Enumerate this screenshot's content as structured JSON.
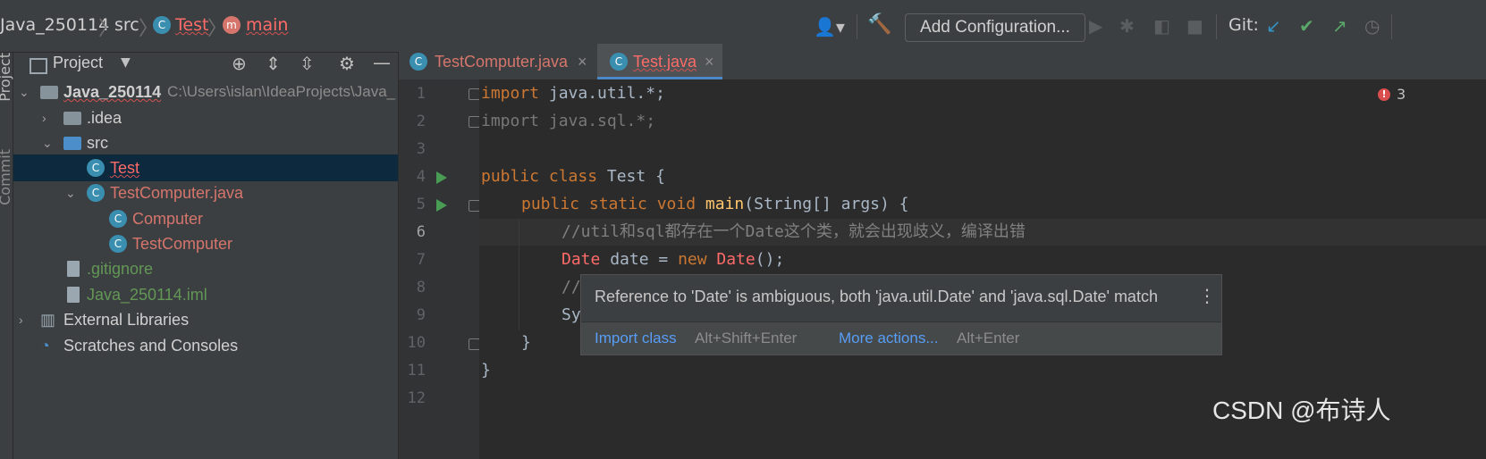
{
  "breadcrumb": {
    "project": "Java_250114",
    "src": "src",
    "class": "Test",
    "method": "main"
  },
  "toolbar": {
    "add_configuration": "Add Configuration...",
    "git_label": "Git:"
  },
  "side_tabs": {
    "project": "Project",
    "commit": "Commit"
  },
  "project_panel": {
    "title": "Project",
    "tree": [
      {
        "label": "Java_250114",
        "path": "C:\\Users\\islan\\IdeaProjects\\Java_"
      },
      {
        "label": ".idea"
      },
      {
        "label": "src"
      },
      {
        "label": "Test"
      },
      {
        "label": "TestComputer.java"
      },
      {
        "label": "Computer"
      },
      {
        "label": "TestComputer"
      },
      {
        "label": ".gitignore"
      },
      {
        "label": "Java_250114.iml"
      },
      {
        "label": "External Libraries"
      },
      {
        "label": "Scratches and Consoles"
      }
    ]
  },
  "editor_tabs": [
    {
      "label": "TestComputer.java"
    },
    {
      "label": "Test.java"
    }
  ],
  "line_numbers": [
    "1",
    "2",
    "3",
    "4",
    "5",
    "6",
    "7",
    "8",
    "9",
    "10",
    "11",
    "12"
  ],
  "code": {
    "l1_kw": "import",
    "l1_rest": " java.util.*;",
    "l2": "import java.sql.*;",
    "l4_kw": "public class",
    "l4_rest": " Test {",
    "l5_kw": "public static void",
    "l5_fn": "main",
    "l5_rest": "(String[] args) {",
    "l6": "//util和sql都存在一个Date这个类，就会出现歧义，编译出错",
    "l7_type": "Date",
    "l7_mid": " date = ",
    "l7_kw": "new",
    "l7_type2": "Date",
    "l7_end": "();",
    "l8": "//",
    "l9": "Sy",
    "l10": "}",
    "l11": "}"
  },
  "error_count": "3",
  "popup": {
    "message": "Reference to 'Date' is ambiguous, both 'java.util.Date' and 'java.sql.Date' match",
    "action1": "Import class",
    "shortcut1": "Alt+Shift+Enter",
    "action2": "More actions...",
    "shortcut2": "Alt+Enter"
  },
  "watermark": "CSDN @布诗人",
  "colors": {
    "keyword": "#cc7832",
    "comment": "#808080",
    "method": "#ffc66d",
    "error": "#ff6b68",
    "link": "#589df6",
    "selection": "#0d293e"
  }
}
